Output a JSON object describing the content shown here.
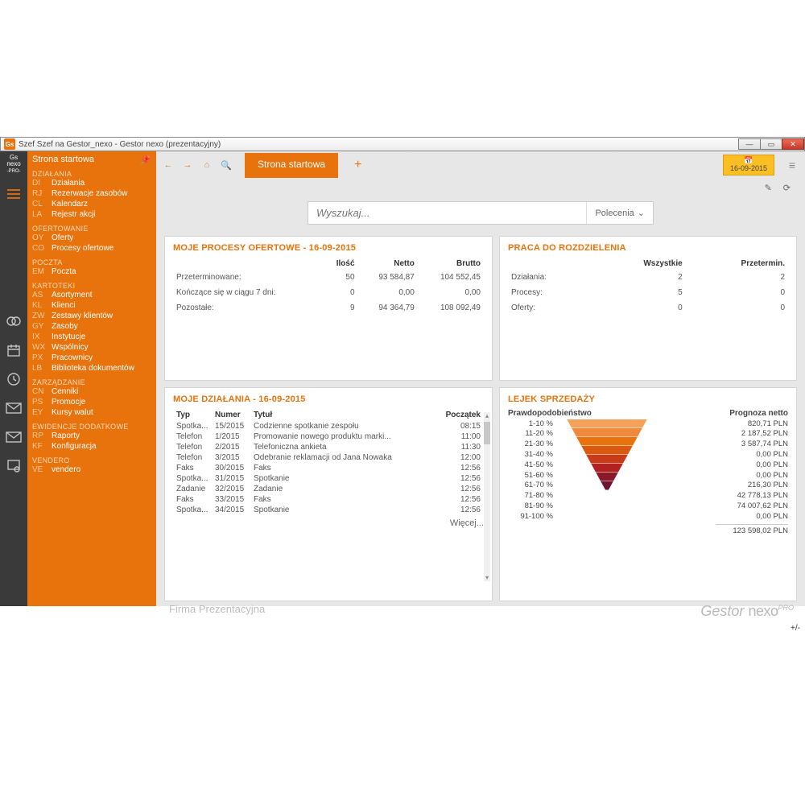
{
  "window_title": "Szef Szef na Gestor_nexo - Gestor nexo (prezentacyjny)",
  "date_badge": "16-09-2015",
  "sidebar": {
    "top": "Strona startowa",
    "groups": [
      {
        "title": "DZIAŁANIA",
        "items": [
          {
            "code": "DI",
            "label": "Działania"
          },
          {
            "code": "RJ",
            "label": "Rezerwacje zasobów"
          },
          {
            "code": "CL",
            "label": "Kalendarz"
          },
          {
            "code": "LA",
            "label": "Rejestr akcji"
          }
        ]
      },
      {
        "title": "OFERTOWANIE",
        "items": [
          {
            "code": "OY",
            "label": "Oferty"
          },
          {
            "code": "CO",
            "label": "Procesy ofertowe"
          }
        ]
      },
      {
        "title": "POCZTA",
        "items": [
          {
            "code": "EM",
            "label": "Poczta"
          }
        ]
      },
      {
        "title": "KARTOTEKI",
        "items": [
          {
            "code": "AS",
            "label": "Asortyment"
          },
          {
            "code": "KL",
            "label": "Klienci"
          },
          {
            "code": "ZW",
            "label": "Zestawy klientów"
          },
          {
            "code": "GY",
            "label": "Zasoby"
          },
          {
            "code": "IX",
            "label": "Instytucje"
          },
          {
            "code": "WX",
            "label": "Wspólnicy"
          },
          {
            "code": "PX",
            "label": "Pracownicy"
          },
          {
            "code": "LB",
            "label": "Biblioteka dokumentów"
          }
        ]
      },
      {
        "title": "ZARZĄDZANIE",
        "items": [
          {
            "code": "CN",
            "label": "Cenniki"
          },
          {
            "code": "PS",
            "label": "Promocje"
          },
          {
            "code": "EY",
            "label": "Kursy walut"
          }
        ]
      },
      {
        "title": "EWIDENCJE DODATKOWE",
        "items": [
          {
            "code": "RP",
            "label": "Raporty"
          },
          {
            "code": "KF",
            "label": "Konfiguracja"
          }
        ]
      },
      {
        "title": "VENDERO",
        "items": [
          {
            "code": "VE",
            "label": "vendero"
          }
        ]
      }
    ]
  },
  "tab_label": "Strona startowa",
  "search_placeholder": "Wyszukaj...",
  "search_menu": "Polecenia",
  "panel1": {
    "title": "MOJE PROCESY OFERTOWE - 16-09-2015",
    "headers": [
      "",
      "Ilość",
      "Netto",
      "Brutto"
    ],
    "rows": [
      [
        "Przeterminowane:",
        "50",
        "93 584,87",
        "104 552,45"
      ],
      [
        "Kończące się w ciągu 7 dni:",
        "0",
        "0,00",
        "0,00"
      ],
      [
        "Pozostałe:",
        "9",
        "94 364,79",
        "108 092,49"
      ]
    ]
  },
  "panel2": {
    "title": "PRACA DO ROZDZIELENIA",
    "headers": [
      "",
      "Wszystkie",
      "Przetermin."
    ],
    "rows": [
      [
        "Działania:",
        "2",
        "2"
      ],
      [
        "Procesy:",
        "5",
        "0"
      ],
      [
        "Oferty:",
        "0",
        "0"
      ]
    ]
  },
  "panel3": {
    "title": "MOJE DZIAŁANIA - 16-09-2015",
    "headers": [
      "Typ",
      "Numer",
      "Tytuł",
      "Początek"
    ],
    "rows": [
      [
        "Spotka...",
        "15/2015",
        "Codzienne spotkanie zespołu",
        "08:15"
      ],
      [
        "Telefon",
        "1/2015",
        "Promowanie nowego produktu marki...",
        "11:00"
      ],
      [
        "Telefon",
        "2/2015",
        "Telefoniczna ankieta",
        "11:30"
      ],
      [
        "Telefon",
        "3/2015",
        "Odebranie reklamacji od Jana Nowaka",
        "12:00"
      ],
      [
        "Faks",
        "30/2015",
        "Faks",
        "12:56"
      ],
      [
        "Spotka...",
        "31/2015",
        "Spotkanie",
        "12:56"
      ],
      [
        "Zadanie",
        "32/2015",
        "Zadanie",
        "12:56"
      ],
      [
        "Faks",
        "33/2015",
        "Faks",
        "12:56"
      ],
      [
        "Spotka...",
        "34/2015",
        "Spotkanie",
        "12:56"
      ]
    ],
    "more": "Więcej..."
  },
  "panel4": {
    "title": "LEJEK SPRZEDAŻY",
    "col1": "Prawdopodobieństwo",
    "col2": "Prognoza netto",
    "labels": [
      "1-10 %",
      "11-20 %",
      "21-30 %",
      "31-40 %",
      "41-50 %",
      "51-60 %",
      "61-70 %",
      "71-80 %",
      "81-90 %",
      "91-100 %"
    ],
    "values": [
      "820,71 PLN",
      "2 187,52 PLN",
      "3 587,74 PLN",
      "0,00 PLN",
      "0,00 PLN",
      "0,00 PLN",
      "216,30 PLN",
      "42 778,13 PLN",
      "74 007,62 PLN",
      "0,00 PLN"
    ],
    "total": "123 598,02 PLN",
    "funnel_colors": [
      "#f5a15a",
      "#ef8a3c",
      "#e8730c",
      "#d95812",
      "#c93a1a",
      "#b02222",
      "#8a1a2a",
      "#6b1530"
    ]
  },
  "company": "Firma Prezentacyjna",
  "brand": "Gestor",
  "brand2": "nexo",
  "brand3": "PRO",
  "pm": "+/-"
}
